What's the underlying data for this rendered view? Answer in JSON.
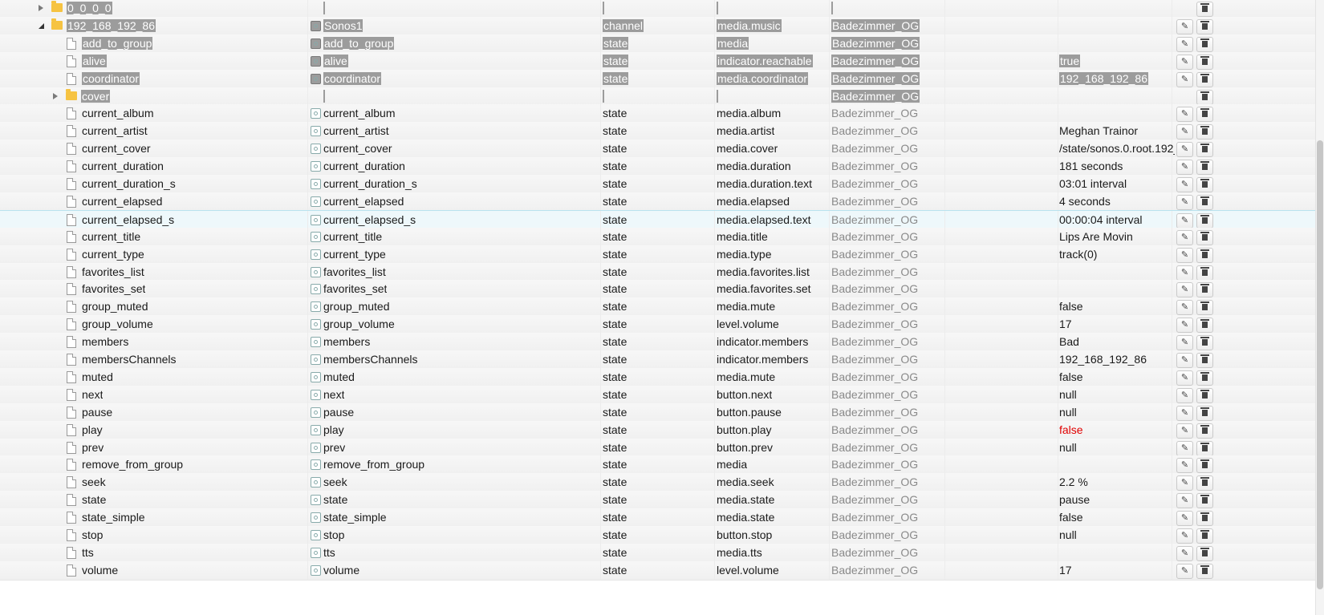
{
  "rows": [
    {
      "indent": 0,
      "type": "folder",
      "toggle": "collapsed",
      "name": "0_0_0_0",
      "selected": true,
      "role": "",
      "type_col": "",
      "room": "",
      "value": "",
      "obj_name": "",
      "name_icon": false,
      "edit": false,
      "del": true
    },
    {
      "indent": 0,
      "type": "folder",
      "toggle": "expanded",
      "name": "192_168_192_86",
      "selected": true,
      "obj_name": "Sonos1",
      "name_icon": true,
      "type_col": "channel",
      "role": "media.music",
      "room": "Badezimmer_OG",
      "value": "",
      "edit": true,
      "del": true
    },
    {
      "indent": 1,
      "type": "file",
      "name": "add_to_group",
      "selected": true,
      "obj_name": "add_to_group",
      "name_icon": true,
      "type_col": "state",
      "role": "media",
      "room": "Badezimmer_OG",
      "value": "",
      "edit": true,
      "del": true
    },
    {
      "indent": 1,
      "type": "file",
      "name": "alive",
      "selected": true,
      "obj_name": "alive",
      "name_icon": true,
      "type_col": "state",
      "role": "indicator.reachable",
      "room": "Badezimmer_OG",
      "value": "true",
      "edit": true,
      "del": true
    },
    {
      "indent": 1,
      "type": "file",
      "name": "coordinator",
      "selected": true,
      "obj_name": "coordinator",
      "name_icon": true,
      "type_col": "state",
      "role": "media.coordinator",
      "room": "Badezimmer_OG",
      "value": "192_168_192_86",
      "edit": true,
      "del": true
    },
    {
      "indent": 1,
      "type": "folder",
      "toggle": "collapsed",
      "name": "cover",
      "selected": true,
      "obj_name": "",
      "name_icon": false,
      "type_col": "",
      "role": "",
      "room": "Badezimmer_OG",
      "value": "",
      "edit": false,
      "del": true
    },
    {
      "indent": 1,
      "type": "file",
      "name": "current_album",
      "obj_name": "current_album",
      "name_icon": true,
      "type_col": "state",
      "role": "media.album",
      "room": "Badezimmer_OG",
      "value": "",
      "edit": true,
      "del": true
    },
    {
      "indent": 1,
      "type": "file",
      "name": "current_artist",
      "obj_name": "current_artist",
      "name_icon": true,
      "type_col": "state",
      "role": "media.artist",
      "room": "Badezimmer_OG",
      "value": "Meghan Trainor",
      "edit": true,
      "del": true
    },
    {
      "indent": 1,
      "type": "file",
      "name": "current_cover",
      "obj_name": "current_cover",
      "name_icon": true,
      "type_col": "state",
      "role": "media.cover",
      "room": "Badezimmer_OG",
      "value": "/state/sonos.0.root.192_",
      "edit": true,
      "del": true
    },
    {
      "indent": 1,
      "type": "file",
      "name": "current_duration",
      "obj_name": "current_duration",
      "name_icon": true,
      "type_col": "state",
      "role": "media.duration",
      "room": "Badezimmer_OG",
      "value": "181 seconds",
      "edit": true,
      "del": true
    },
    {
      "indent": 1,
      "type": "file",
      "name": "current_duration_s",
      "obj_name": "current_duration_s",
      "name_icon": true,
      "type_col": "state",
      "role": "media.duration.text",
      "room": "Badezimmer_OG",
      "value": "03:01 interval",
      "edit": true,
      "del": true
    },
    {
      "indent": 1,
      "type": "file",
      "name": "current_elapsed",
      "obj_name": "current_elapsed",
      "name_icon": true,
      "type_col": "state",
      "role": "media.elapsed",
      "room": "Badezimmer_OG",
      "value": "4 seconds",
      "edit": true,
      "del": true
    },
    {
      "indent": 1,
      "type": "file",
      "name": "current_elapsed_s",
      "obj_name": "current_elapsed_s",
      "name_icon": true,
      "type_col": "state",
      "role": "media.elapsed.text",
      "room": "Badezimmer_OG",
      "value": "00:00:04 interval",
      "edit": true,
      "del": true,
      "highlight": true
    },
    {
      "indent": 1,
      "type": "file",
      "name": "current_title",
      "obj_name": "current_title",
      "name_icon": true,
      "type_col": "state",
      "role": "media.title",
      "room": "Badezimmer_OG",
      "value": "Lips Are Movin",
      "edit": true,
      "del": true
    },
    {
      "indent": 1,
      "type": "file",
      "name": "current_type",
      "obj_name": "current_type",
      "name_icon": true,
      "type_col": "state",
      "role": "media.type",
      "room": "Badezimmer_OG",
      "value": "track(0)",
      "edit": true,
      "del": true
    },
    {
      "indent": 1,
      "type": "file",
      "name": "favorites_list",
      "obj_name": "favorites_list",
      "name_icon": true,
      "type_col": "state",
      "role": "media.favorites.list",
      "room": "Badezimmer_OG",
      "value": "",
      "edit": true,
      "del": true
    },
    {
      "indent": 1,
      "type": "file",
      "name": "favorites_set",
      "obj_name": "favorites_set",
      "name_icon": true,
      "type_col": "state",
      "role": "media.favorites.set",
      "room": "Badezimmer_OG",
      "value": "",
      "edit": true,
      "del": true
    },
    {
      "indent": 1,
      "type": "file",
      "name": "group_muted",
      "obj_name": "group_muted",
      "name_icon": true,
      "type_col": "state",
      "role": "media.mute",
      "room": "Badezimmer_OG",
      "value": "false",
      "edit": true,
      "del": true
    },
    {
      "indent": 1,
      "type": "file",
      "name": "group_volume",
      "obj_name": "group_volume",
      "name_icon": true,
      "type_col": "state",
      "role": "level.volume",
      "room": "Badezimmer_OG",
      "value": "17",
      "edit": true,
      "del": true
    },
    {
      "indent": 1,
      "type": "file",
      "name": "members",
      "obj_name": "members",
      "name_icon": true,
      "type_col": "state",
      "role": "indicator.members",
      "room": "Badezimmer_OG",
      "value": "Bad",
      "edit": true,
      "del": true
    },
    {
      "indent": 1,
      "type": "file",
      "name": "membersChannels",
      "obj_name": "membersChannels",
      "name_icon": true,
      "type_col": "state",
      "role": "indicator.members",
      "room": "Badezimmer_OG",
      "value": "192_168_192_86",
      "edit": true,
      "del": true
    },
    {
      "indent": 1,
      "type": "file",
      "name": "muted",
      "obj_name": "muted",
      "name_icon": true,
      "type_col": "state",
      "role": "media.mute",
      "room": "Badezimmer_OG",
      "value": "false",
      "edit": true,
      "del": true
    },
    {
      "indent": 1,
      "type": "file",
      "name": "next",
      "obj_name": "next",
      "name_icon": true,
      "type_col": "state",
      "role": "button.next",
      "room": "Badezimmer_OG",
      "value": "null",
      "edit": true,
      "del": true
    },
    {
      "indent": 1,
      "type": "file",
      "name": "pause",
      "obj_name": "pause",
      "name_icon": true,
      "type_col": "state",
      "role": "button.pause",
      "room": "Badezimmer_OG",
      "value": "null",
      "edit": true,
      "del": true
    },
    {
      "indent": 1,
      "type": "file",
      "name": "play",
      "obj_name": "play",
      "name_icon": true,
      "type_col": "state",
      "role": "button.play",
      "room": "Badezimmer_OG",
      "value": "false",
      "value_red": true,
      "edit": true,
      "del": true
    },
    {
      "indent": 1,
      "type": "file",
      "name": "prev",
      "obj_name": "prev",
      "name_icon": true,
      "type_col": "state",
      "role": "button.prev",
      "room": "Badezimmer_OG",
      "value": "null",
      "edit": true,
      "del": true
    },
    {
      "indent": 1,
      "type": "file",
      "name": "remove_from_group",
      "obj_name": "remove_from_group",
      "name_icon": true,
      "type_col": "state",
      "role": "media",
      "room": "Badezimmer_OG",
      "value": "",
      "edit": true,
      "del": true
    },
    {
      "indent": 1,
      "type": "file",
      "name": "seek",
      "obj_name": "seek",
      "name_icon": true,
      "type_col": "state",
      "role": "media.seek",
      "room": "Badezimmer_OG",
      "value": "2.2 %",
      "edit": true,
      "del": true
    },
    {
      "indent": 1,
      "type": "file",
      "name": "state",
      "obj_name": "state",
      "name_icon": true,
      "type_col": "state",
      "role": "media.state",
      "room": "Badezimmer_OG",
      "value": "pause",
      "edit": true,
      "del": true
    },
    {
      "indent": 1,
      "type": "file",
      "name": "state_simple",
      "obj_name": "state_simple",
      "name_icon": true,
      "type_col": "state",
      "role": "media.state",
      "room": "Badezimmer_OG",
      "value": "false",
      "edit": true,
      "del": true
    },
    {
      "indent": 1,
      "type": "file",
      "name": "stop",
      "obj_name": "stop",
      "name_icon": true,
      "type_col": "state",
      "role": "button.stop",
      "room": "Badezimmer_OG",
      "value": "null",
      "edit": true,
      "del": true
    },
    {
      "indent": 1,
      "type": "file",
      "name": "tts",
      "obj_name": "tts",
      "name_icon": true,
      "type_col": "state",
      "role": "media.tts",
      "room": "Badezimmer_OG",
      "value": "",
      "edit": true,
      "del": true
    },
    {
      "indent": 1,
      "type": "file",
      "name": "volume",
      "obj_name": "volume",
      "name_icon": true,
      "type_col": "state",
      "role": "level.volume",
      "room": "Badezimmer_OG",
      "value": "17",
      "edit": true,
      "del": true
    }
  ],
  "icons": {
    "edit": "pencil-icon",
    "delete": "trash-icon",
    "file": "file-icon",
    "folder": "folder-icon",
    "state": "state-icon"
  },
  "colors": {
    "selection": "#9c9c9c",
    "room_text": "#8a8a8a",
    "value_alert": "#e00000",
    "highlight_row": "#eef8fb"
  }
}
